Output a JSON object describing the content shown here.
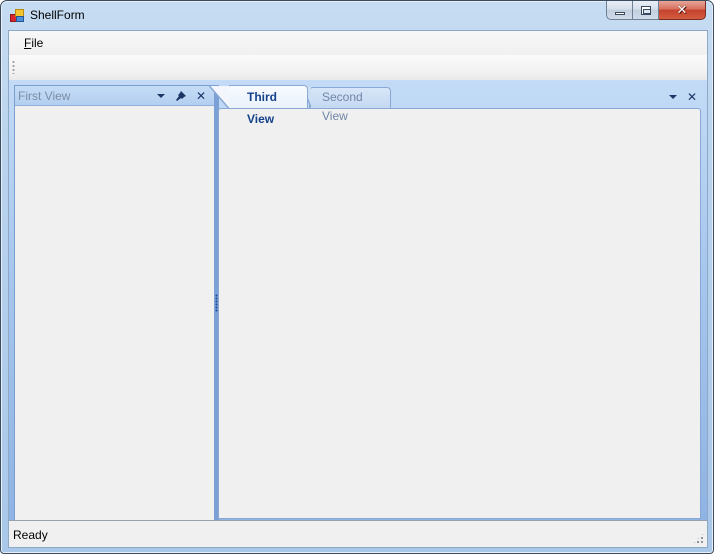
{
  "window": {
    "title": "ShellForm",
    "icon": "app-icon",
    "caption_buttons": [
      {
        "name": "minimize",
        "icon": "minimize-icon"
      },
      {
        "name": "maximize",
        "icon": "maximize-icon"
      },
      {
        "name": "close",
        "icon": "close-icon",
        "glyph": "✕"
      }
    ]
  },
  "menubar": {
    "items": [
      {
        "label": "File",
        "mnemonic": "F",
        "rest": "ile"
      }
    ]
  },
  "left_panel": {
    "title": "First View",
    "buttons": [
      {
        "name": "dropdown",
        "icon": "chevron-down-icon"
      },
      {
        "name": "pin",
        "icon": "pin-icon",
        "glyph": "📌"
      },
      {
        "name": "close",
        "icon": "close-icon",
        "glyph": "✕"
      }
    ]
  },
  "document_area": {
    "tabs": [
      {
        "label": "Third View",
        "active": true
      },
      {
        "label": "Second View",
        "active": false
      }
    ],
    "buttons": [
      {
        "name": "dropdown",
        "icon": "chevron-down-icon"
      },
      {
        "name": "close",
        "icon": "close-icon",
        "glyph": "✕"
      }
    ]
  },
  "statusbar": {
    "text": "Ready"
  },
  "colors": {
    "active_tab_text": "#15428b",
    "inactive_text": "#6f86a7",
    "dock_background": "#a9c8ee",
    "panel_background": "#f0f0f0",
    "close_button": "#c5422c"
  }
}
